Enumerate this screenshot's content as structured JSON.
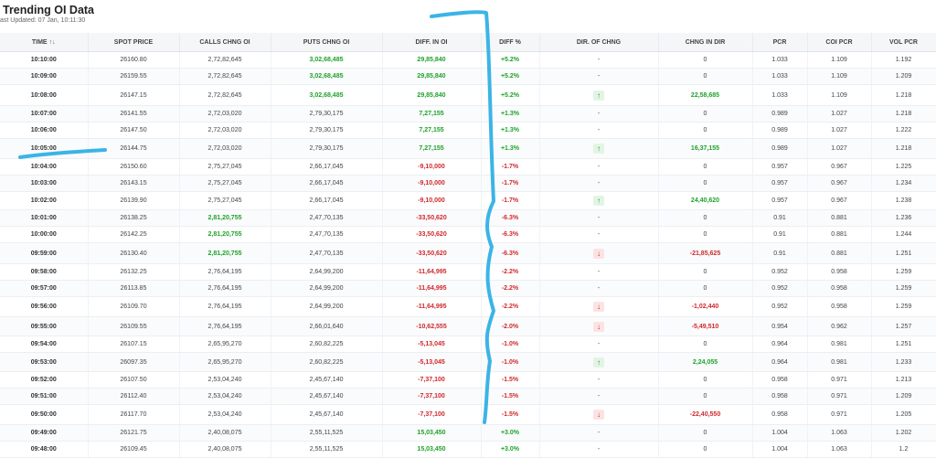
{
  "header": {
    "title": "Trending OI Data",
    "last_updated": "ast Updated:  07 Jan, 10:11:30"
  },
  "table": {
    "columns": [
      "TIME",
      "SPOT PRICE",
      "CALLS CHNG OI",
      "PUTS CHNG OI",
      "DIFF. IN OI",
      "DIFF %",
      "DIR. OF CHNG",
      "CHNG IN DIR",
      "PCR",
      "COI PCR",
      "VOL PCR"
    ],
    "sort_icon": "↑↓",
    "rows": [
      {
        "time": "10:10:00",
        "spot": "26160.80",
        "calls": "2,72,82,645",
        "calls_hl": false,
        "puts": "3,02,68,485",
        "puts_hl": true,
        "diff": "29,85,840",
        "diff_sign": "pos",
        "pct": "+5.2%",
        "dir": "-",
        "dir_type": "none",
        "chng": "0",
        "chng_sign": "none",
        "pcr": "1.033",
        "coi": "1.109",
        "vol": "1.192"
      },
      {
        "time": "10:09:00",
        "spot": "26159.55",
        "calls": "2,72,82,645",
        "calls_hl": false,
        "puts": "3,02,68,485",
        "puts_hl": true,
        "diff": "29,85,840",
        "diff_sign": "pos",
        "pct": "+5.2%",
        "dir": "-",
        "dir_type": "none",
        "chng": "0",
        "chng_sign": "none",
        "pcr": "1.033",
        "coi": "1.109",
        "vol": "1.209"
      },
      {
        "time": "10:08:00",
        "spot": "26147.15",
        "calls": "2,72,82,645",
        "calls_hl": false,
        "puts": "3,02,68,485",
        "puts_hl": true,
        "diff": "29,85,840",
        "diff_sign": "pos",
        "pct": "+5.2%",
        "dir": "↑",
        "dir_type": "up",
        "chng": "22,58,685",
        "chng_sign": "pos",
        "pcr": "1.033",
        "coi": "1.109",
        "vol": "1.218"
      },
      {
        "time": "10:07:00",
        "spot": "26141.55",
        "calls": "2,72,03,020",
        "calls_hl": false,
        "puts": "2,79,30,175",
        "puts_hl": false,
        "diff": "7,27,155",
        "diff_sign": "pos",
        "pct": "+1.3%",
        "dir": "-",
        "dir_type": "none",
        "chng": "0",
        "chng_sign": "none",
        "pcr": "0.989",
        "coi": "1.027",
        "vol": "1.218"
      },
      {
        "time": "10:06:00",
        "spot": "26147.50",
        "calls": "2,72,03,020",
        "calls_hl": false,
        "puts": "2,79,30,175",
        "puts_hl": false,
        "diff": "7,27,155",
        "diff_sign": "pos",
        "pct": "+1.3%",
        "dir": "-",
        "dir_type": "none",
        "chng": "0",
        "chng_sign": "none",
        "pcr": "0.989",
        "coi": "1.027",
        "vol": "1.222"
      },
      {
        "time": "10:05:00",
        "spot": "26144.75",
        "calls": "2,72,03,020",
        "calls_hl": false,
        "puts": "2,79,30,175",
        "puts_hl": false,
        "diff": "7,27,155",
        "diff_sign": "pos",
        "pct": "+1.3%",
        "dir": "↑",
        "dir_type": "up",
        "chng": "16,37,155",
        "chng_sign": "pos",
        "pcr": "0.989",
        "coi": "1.027",
        "vol": "1.218"
      },
      {
        "time": "10:04:00",
        "spot": "26150.60",
        "calls": "2,75,27,045",
        "calls_hl": false,
        "puts": "2,66,17,045",
        "puts_hl": false,
        "diff": "-9,10,000",
        "diff_sign": "neg",
        "pct": "-1.7%",
        "dir": "-",
        "dir_type": "none",
        "chng": "0",
        "chng_sign": "none",
        "pcr": "0.957",
        "coi": "0.967",
        "vol": "1.225"
      },
      {
        "time": "10:03:00",
        "spot": "26143.15",
        "calls": "2,75,27,045",
        "calls_hl": false,
        "puts": "2,66,17,045",
        "puts_hl": false,
        "diff": "-9,10,000",
        "diff_sign": "neg",
        "pct": "-1.7%",
        "dir": "-",
        "dir_type": "none",
        "chng": "0",
        "chng_sign": "none",
        "pcr": "0.957",
        "coi": "0.967",
        "vol": "1.234"
      },
      {
        "time": "10:02:00",
        "spot": "26139.90",
        "calls": "2,75,27,045",
        "calls_hl": false,
        "puts": "2,66,17,045",
        "puts_hl": false,
        "diff": "-9,10,000",
        "diff_sign": "neg",
        "pct": "-1.7%",
        "dir": "↑",
        "dir_type": "up",
        "chng": "24,40,620",
        "chng_sign": "pos",
        "pcr": "0.957",
        "coi": "0.967",
        "vol": "1.238"
      },
      {
        "time": "10:01:00",
        "spot": "26138.25",
        "calls": "2,81,20,755",
        "calls_hl": true,
        "puts": "2,47,70,135",
        "puts_hl": false,
        "diff": "-33,50,620",
        "diff_sign": "neg",
        "pct": "-6.3%",
        "dir": "-",
        "dir_type": "none",
        "chng": "0",
        "chng_sign": "none",
        "pcr": "0.91",
        "coi": "0.881",
        "vol": "1.236"
      },
      {
        "time": "10:00:00",
        "spot": "26142.25",
        "calls": "2,81,20,755",
        "calls_hl": true,
        "puts": "2,47,70,135",
        "puts_hl": false,
        "diff": "-33,50,620",
        "diff_sign": "neg",
        "pct": "-6.3%",
        "dir": "-",
        "dir_type": "none",
        "chng": "0",
        "chng_sign": "none",
        "pcr": "0.91",
        "coi": "0.881",
        "vol": "1.244"
      },
      {
        "time": "09:59:00",
        "spot": "26130.40",
        "calls": "2,81,20,755",
        "calls_hl": true,
        "puts": "2,47,70,135",
        "puts_hl": false,
        "diff": "-33,50,620",
        "diff_sign": "neg",
        "pct": "-6.3%",
        "dir": "↓",
        "dir_type": "down",
        "chng": "-21,85,625",
        "chng_sign": "neg",
        "pcr": "0.91",
        "coi": "0.881",
        "vol": "1.251"
      },
      {
        "time": "09:58:00",
        "spot": "26132.25",
        "calls": "2,76,64,195",
        "calls_hl": false,
        "puts": "2,64,99,200",
        "puts_hl": false,
        "diff": "-11,64,995",
        "diff_sign": "neg",
        "pct": "-2.2%",
        "dir": "-",
        "dir_type": "none",
        "chng": "0",
        "chng_sign": "none",
        "pcr": "0.952",
        "coi": "0.958",
        "vol": "1.259"
      },
      {
        "time": "09:57:00",
        "spot": "26113.85",
        "calls": "2,76,64,195",
        "calls_hl": false,
        "puts": "2,64,99,200",
        "puts_hl": false,
        "diff": "-11,64,995",
        "diff_sign": "neg",
        "pct": "-2.2%",
        "dir": "-",
        "dir_type": "none",
        "chng": "0",
        "chng_sign": "none",
        "pcr": "0.952",
        "coi": "0.958",
        "vol": "1.259"
      },
      {
        "time": "09:56:00",
        "spot": "26109.70",
        "calls": "2,76,64,195",
        "calls_hl": false,
        "puts": "2,64,99,200",
        "puts_hl": false,
        "diff": "-11,64,995",
        "diff_sign": "neg",
        "pct": "-2.2%",
        "dir": "↓",
        "dir_type": "down",
        "chng": "-1,02,440",
        "chng_sign": "neg",
        "pcr": "0.952",
        "coi": "0.958",
        "vol": "1.259"
      },
      {
        "time": "09:55:00",
        "spot": "26109.55",
        "calls": "2,76,64,195",
        "calls_hl": false,
        "puts": "2,66,01,640",
        "puts_hl": false,
        "diff": "-10,62,555",
        "diff_sign": "neg",
        "pct": "-2.0%",
        "dir": "↓",
        "dir_type": "down",
        "chng": "-5,49,510",
        "chng_sign": "neg",
        "pcr": "0.954",
        "coi": "0.962",
        "vol": "1.257"
      },
      {
        "time": "09:54:00",
        "spot": "26107.15",
        "calls": "2,65,95,270",
        "calls_hl": false,
        "puts": "2,60,82,225",
        "puts_hl": false,
        "diff": "-5,13,045",
        "diff_sign": "neg",
        "pct": "-1.0%",
        "dir": "-",
        "dir_type": "none",
        "chng": "0",
        "chng_sign": "none",
        "pcr": "0.964",
        "coi": "0.981",
        "vol": "1.251"
      },
      {
        "time": "09:53:00",
        "spot": "26097.35",
        "calls": "2,65,95,270",
        "calls_hl": false,
        "puts": "2,60,82,225",
        "puts_hl": false,
        "diff": "-5,13,045",
        "diff_sign": "neg",
        "pct": "-1.0%",
        "dir": "↑",
        "dir_type": "up",
        "chng": "2,24,055",
        "chng_sign": "pos",
        "pcr": "0.964",
        "coi": "0.981",
        "vol": "1.233"
      },
      {
        "time": "09:52:00",
        "spot": "26107.50",
        "calls": "2,53,04,240",
        "calls_hl": false,
        "puts": "2,45,67,140",
        "puts_hl": false,
        "diff": "-7,37,100",
        "diff_sign": "neg",
        "pct": "-1.5%",
        "dir": "-",
        "dir_type": "none",
        "chng": "0",
        "chng_sign": "none",
        "pcr": "0.958",
        "coi": "0.971",
        "vol": "1.213"
      },
      {
        "time": "09:51:00",
        "spot": "26112.40",
        "calls": "2,53,04,240",
        "calls_hl": false,
        "puts": "2,45,67,140",
        "puts_hl": false,
        "diff": "-7,37,100",
        "diff_sign": "neg",
        "pct": "-1.5%",
        "dir": "-",
        "dir_type": "none",
        "chng": "0",
        "chng_sign": "none",
        "pcr": "0.958",
        "coi": "0.971",
        "vol": "1.209"
      },
      {
        "time": "09:50:00",
        "spot": "26117.70",
        "calls": "2,53,04,240",
        "calls_hl": false,
        "puts": "2,45,67,140",
        "puts_hl": false,
        "diff": "-7,37,100",
        "diff_sign": "neg",
        "pct": "-1.5%",
        "dir": "↓",
        "dir_type": "down",
        "chng": "-22,40,550",
        "chng_sign": "neg",
        "pcr": "0.958",
        "coi": "0.971",
        "vol": "1.205"
      },
      {
        "time": "09:49:00",
        "spot": "26121.75",
        "calls": "2,40,08,075",
        "calls_hl": false,
        "puts": "2,55,11,525",
        "puts_hl": false,
        "diff": "15,03,450",
        "diff_sign": "pos",
        "pct": "+3.0%",
        "dir": "-",
        "dir_type": "none",
        "chng": "0",
        "chng_sign": "none",
        "pcr": "1.004",
        "coi": "1.063",
        "vol": "1.202"
      },
      {
        "time": "09:48:00",
        "spot": "26109.45",
        "calls": "2,40,08,075",
        "calls_hl": false,
        "puts": "2,55,11,525",
        "puts_hl": false,
        "diff": "15,03,450",
        "diff_sign": "pos",
        "pct": "+3.0%",
        "dir": "-",
        "dir_type": "none",
        "chng": "0",
        "chng_sign": "none",
        "pcr": "1.004",
        "coi": "1.063",
        "vol": "1.2"
      }
    ]
  },
  "annotation": {
    "stroke_color": "#3bb4e6"
  }
}
